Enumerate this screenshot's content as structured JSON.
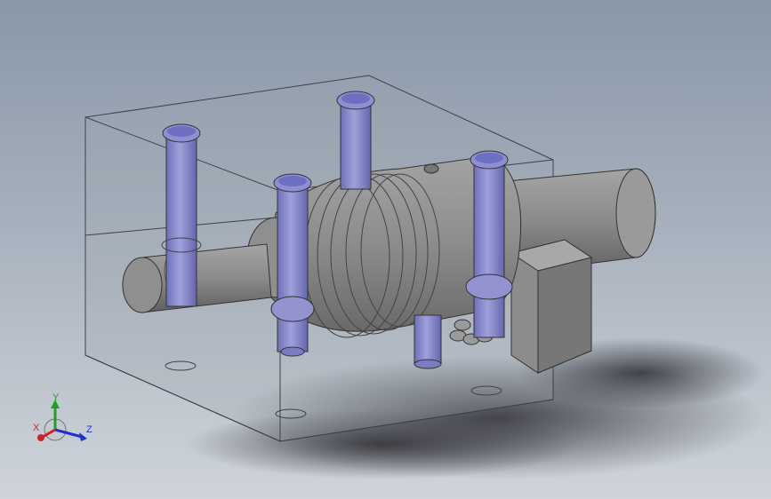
{
  "colors": {
    "background_top": "#8997a8",
    "background_bottom": "#cfd4da",
    "shaft": "#8a8a8a",
    "bolt": "#8e8fd0",
    "bolt_top": "#6c6fc2",
    "block_edge": "#3e4248",
    "shadow": "#3e3e44",
    "triad_x": "#d02020",
    "triad_y": "#20a020",
    "triad_z": "#2030d0"
  },
  "triad": {
    "x_label": "X",
    "y_label": "Y",
    "z_label": "Z"
  },
  "icons": [
    "view-orientation-triad-icon"
  ]
}
